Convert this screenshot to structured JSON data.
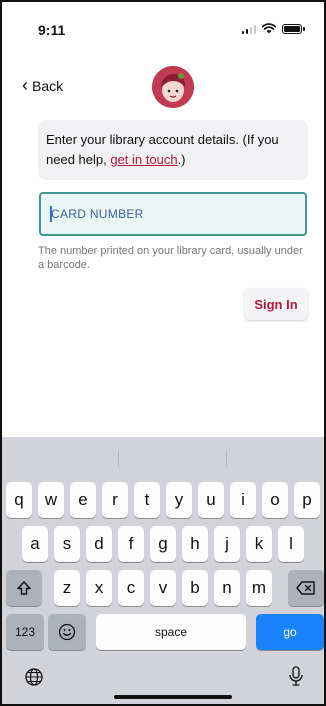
{
  "status_bar": {
    "time": "9:11",
    "wifi_icon": "wifi-icon",
    "battery_icon": "battery-icon",
    "signal_icon": "signal-icon"
  },
  "nav": {
    "back_label": "Back",
    "back_icon": "chevron-left-icon",
    "logo_icon": "libby-logo-icon"
  },
  "message": {
    "text_before": "Enter your library account details. (If you need help, ",
    "link_text": "get in touch",
    "text_after": ".)"
  },
  "card_input": {
    "placeholder": "CARD NUMBER",
    "value": ""
  },
  "help_text": "The number printed on your library card, usually under a barcode.",
  "sign_in_label": "Sign In",
  "colors": {
    "accent": "#b4183a",
    "input_border": "#3c9a8d",
    "keyboard_bg": "#d1d3d9",
    "go_key": "#1a82fb"
  },
  "keyboard": {
    "row1": [
      "q",
      "w",
      "e",
      "r",
      "t",
      "y",
      "u",
      "i",
      "o",
      "p"
    ],
    "row2": [
      "a",
      "s",
      "d",
      "f",
      "g",
      "h",
      "j",
      "k",
      "l"
    ],
    "row3": [
      "z",
      "x",
      "c",
      "v",
      "b",
      "n",
      "m"
    ],
    "numbers_label": "123",
    "space_label": "space",
    "go_label": "go",
    "shift_icon": "shift-icon",
    "delete_icon": "delete-icon",
    "emoji_icon": "emoji-icon",
    "globe_icon": "globe-icon",
    "mic_icon": "microphone-icon"
  }
}
